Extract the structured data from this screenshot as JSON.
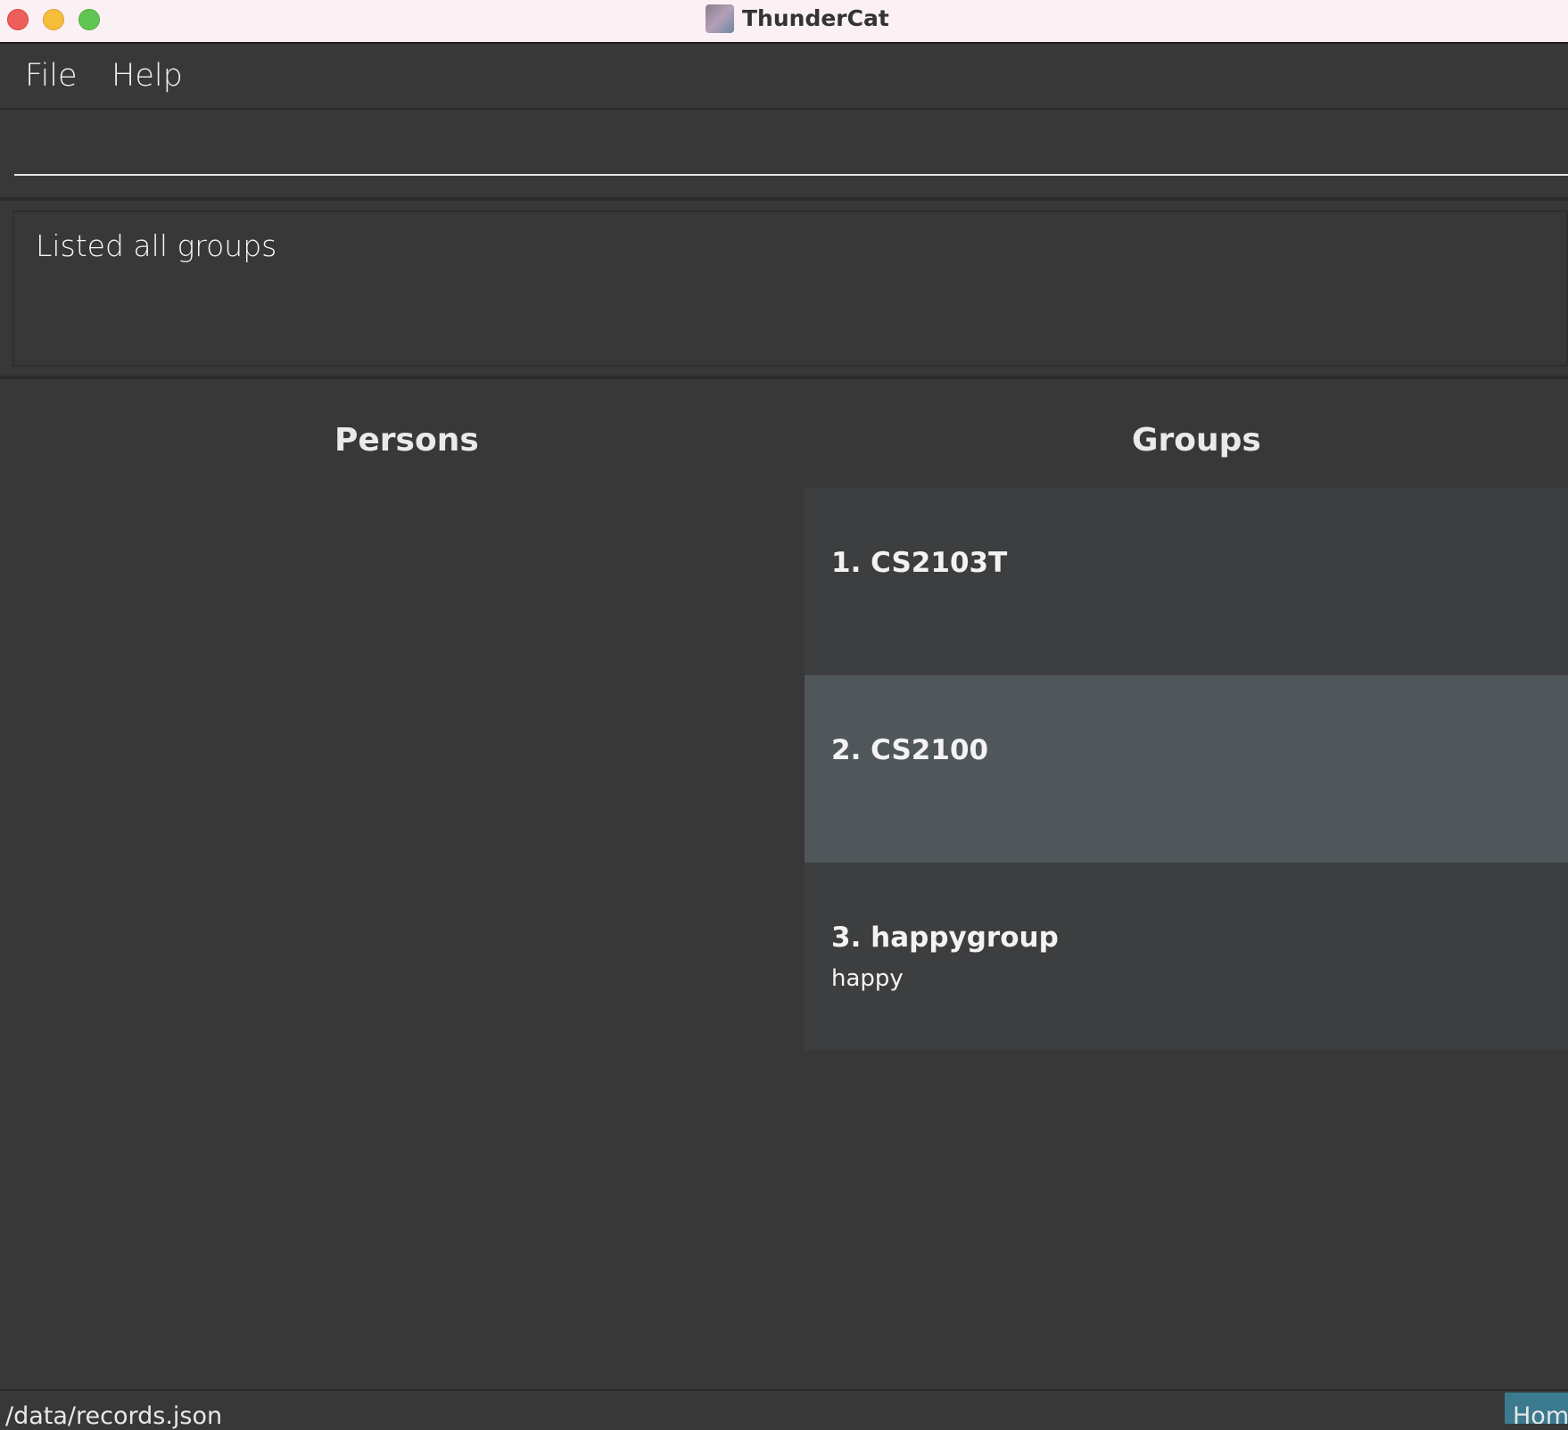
{
  "window": {
    "title": "ThunderCat"
  },
  "menu": {
    "items": [
      "File",
      "Help"
    ]
  },
  "command": {
    "value": "",
    "placeholder": ""
  },
  "result": {
    "message": "Listed all groups"
  },
  "panels": {
    "persons_title": "Persons",
    "groups_title": "Groups"
  },
  "groups": [
    {
      "index": "1.",
      "name": "CS2103T",
      "description": ""
    },
    {
      "index": "2.",
      "name": "CS2100",
      "description": ""
    },
    {
      "index": "3.",
      "name": "happygroup",
      "description": "happy"
    }
  ],
  "status": {
    "path": "/data/records.json",
    "home_tab": "Home"
  }
}
